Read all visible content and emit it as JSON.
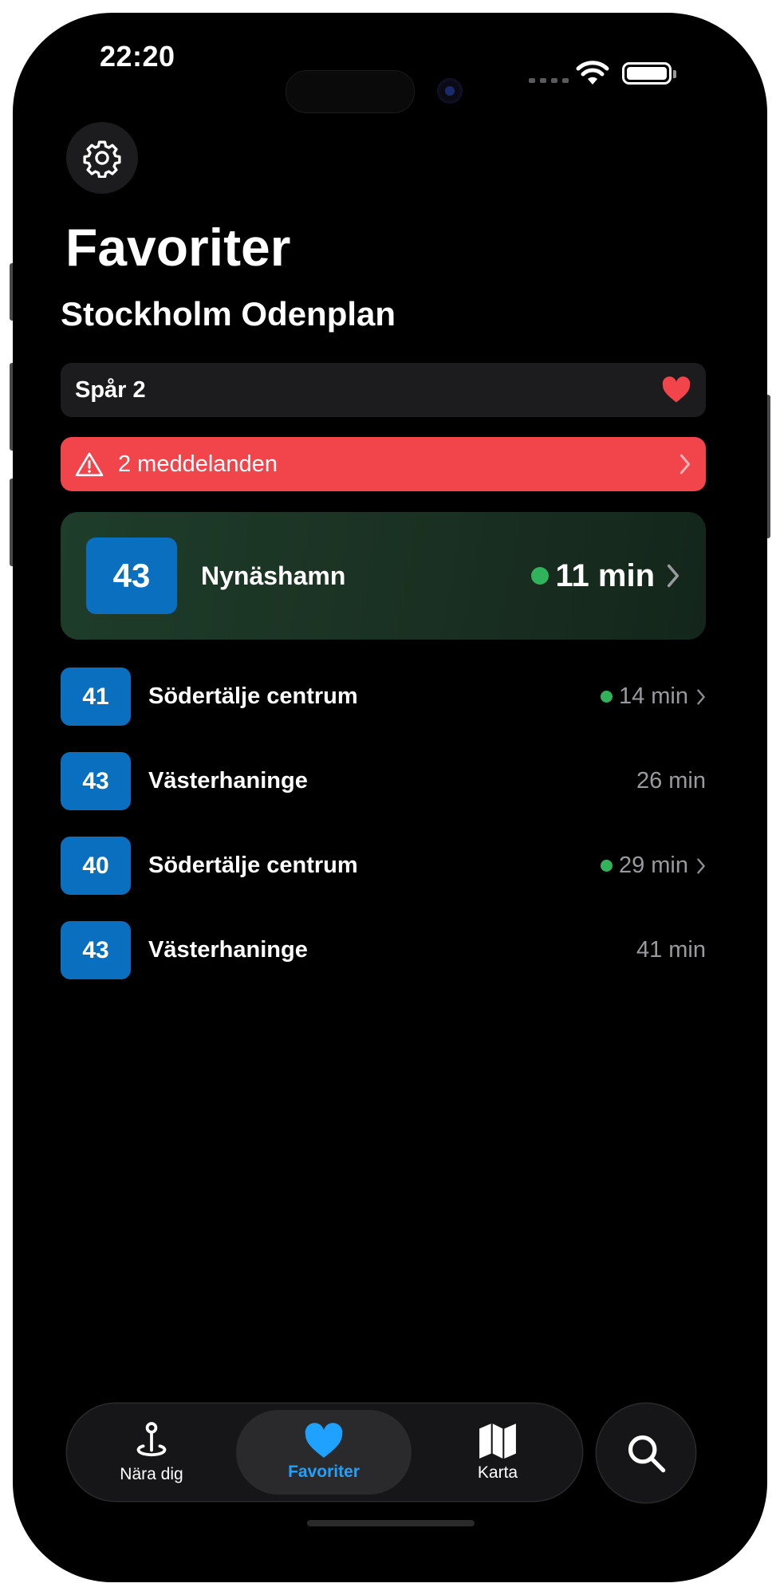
{
  "status": {
    "time": "22:20"
  },
  "header": {
    "title": "Favoriter",
    "station": "Stockholm Odenplan"
  },
  "track": {
    "label": "Spår 2",
    "favorite_icon": "heart-icon",
    "favorite_color": "#f1444b"
  },
  "alert": {
    "label": "2 meddelanden",
    "color": "#f1444b"
  },
  "featured": {
    "line": "43",
    "destination": "Nynäshamn",
    "time": "11 min",
    "realtime": true
  },
  "departures": [
    {
      "line": "41",
      "destination": "Södertälje centrum",
      "time": "14 min",
      "realtime": true
    },
    {
      "line": "43",
      "destination": "Västerhaninge",
      "time": "26 min",
      "realtime": false
    },
    {
      "line": "40",
      "destination": "Södertälje centrum",
      "time": "29 min",
      "realtime": true
    },
    {
      "line": "43",
      "destination": "Västerhaninge",
      "time": "41 min",
      "realtime": false
    }
  ],
  "tabs": [
    {
      "label": "Nära dig",
      "icon": "location-pin-icon"
    },
    {
      "label": "Favoriter",
      "icon": "heart-icon",
      "active": true
    },
    {
      "label": "Karta",
      "icon": "map-icon"
    }
  ],
  "colors": {
    "accent": "#1fa2ff",
    "line_badge": "#0a6fbe",
    "realtime_dot": "#30b35a"
  }
}
